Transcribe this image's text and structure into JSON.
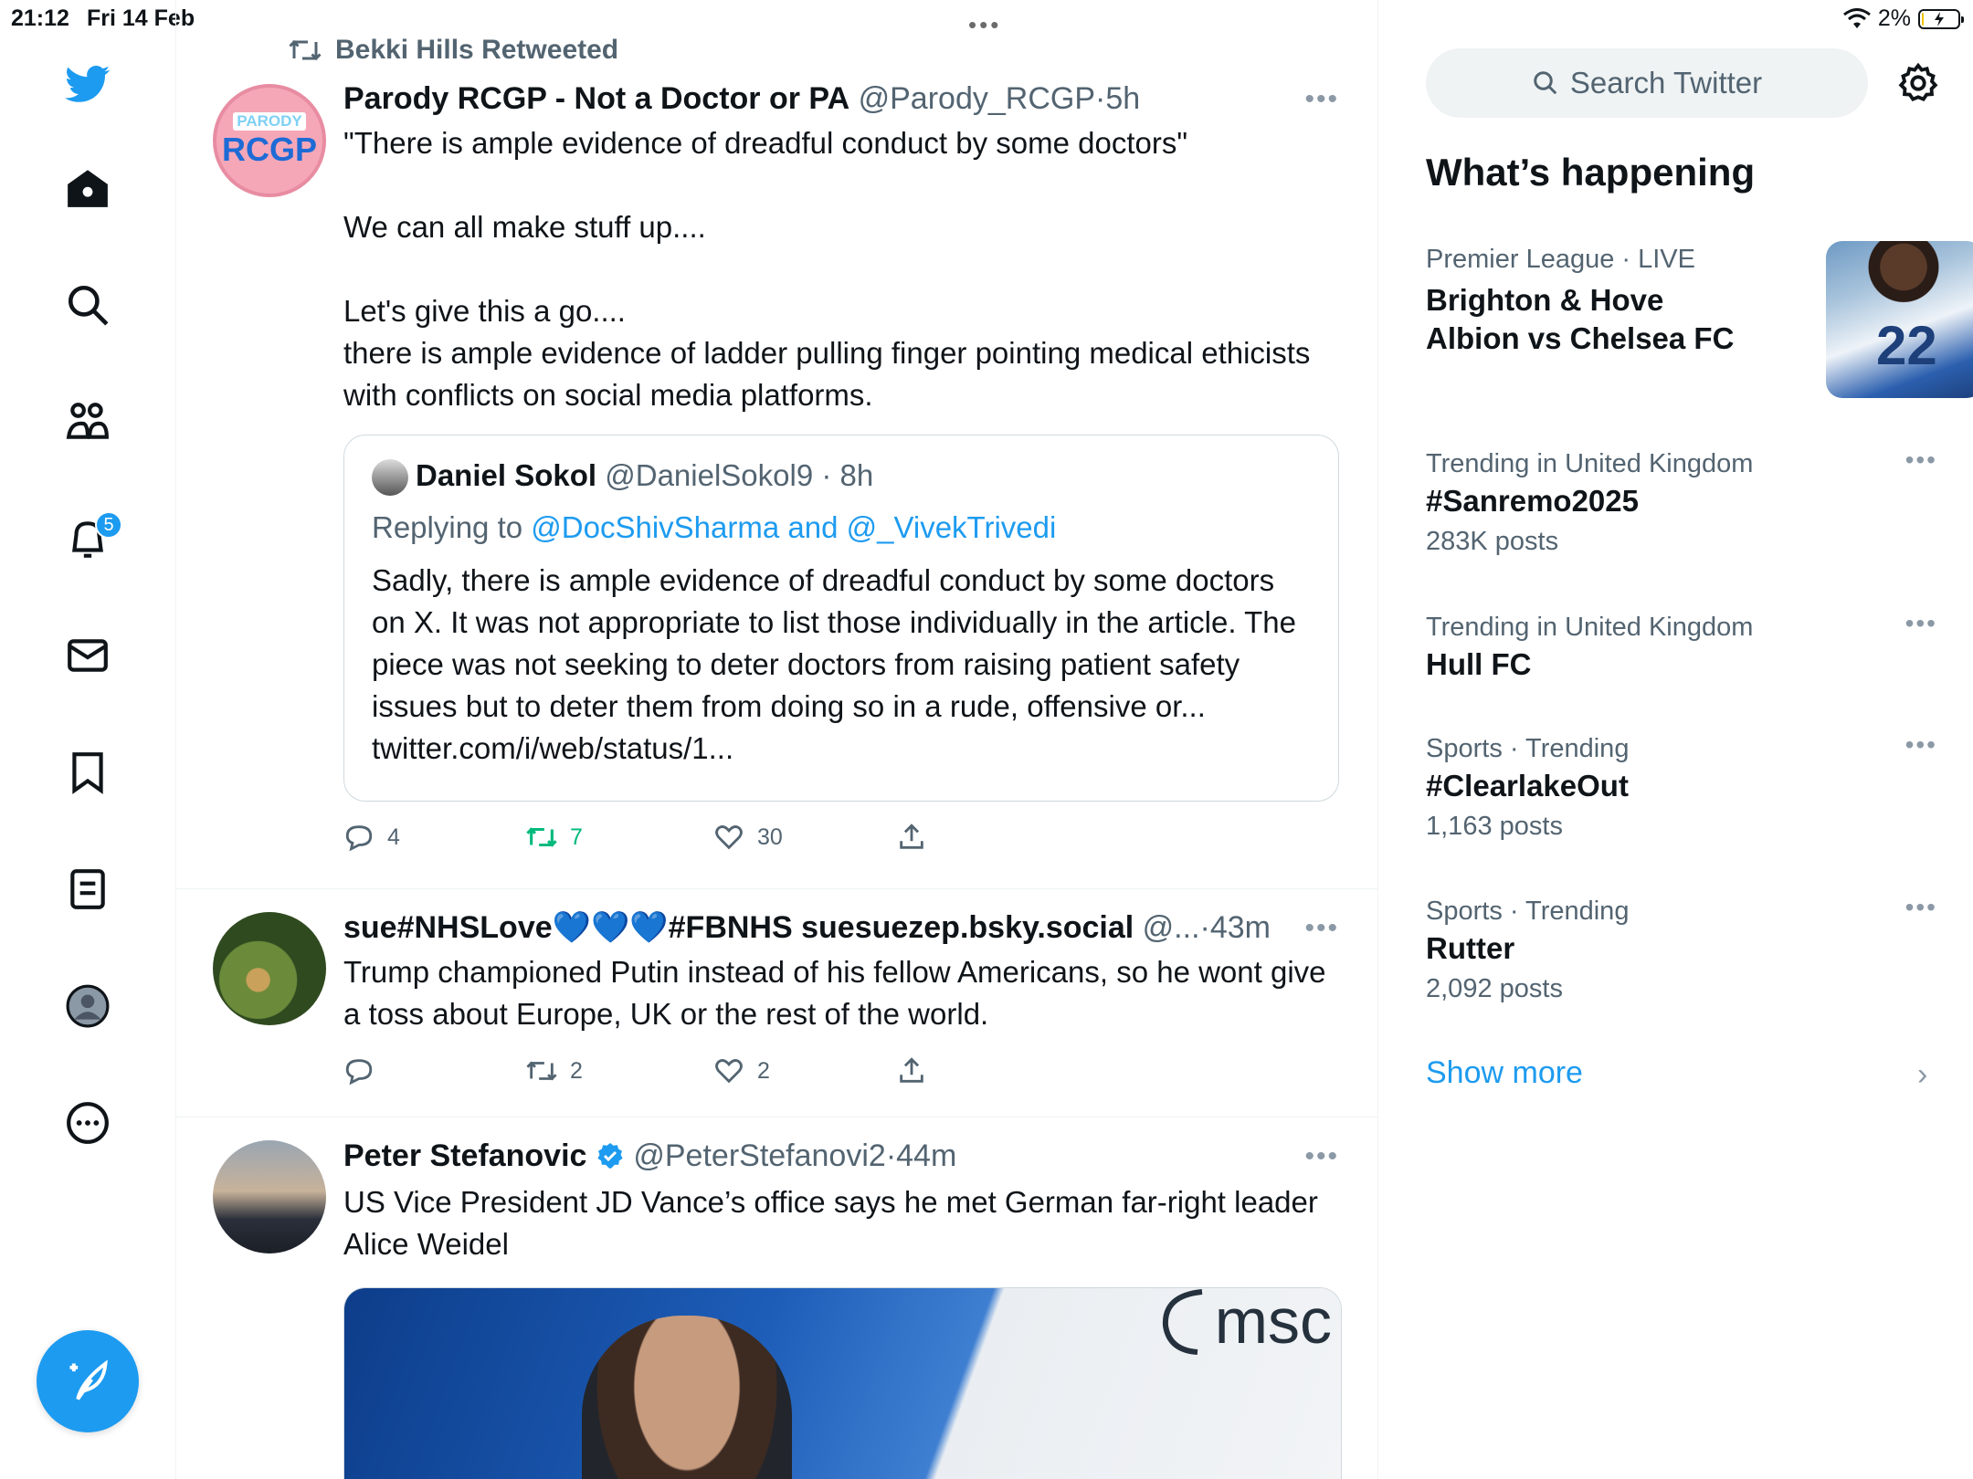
{
  "status_bar": {
    "time": "21:12",
    "date": "Fri 14 Feb",
    "battery": "2%",
    "battery_level": 0.02
  },
  "nav": {
    "notifications_badge": "5",
    "icons": [
      "twitter-logo-icon",
      "home-icon",
      "search-icon",
      "communities-icon",
      "notifications-icon",
      "messages-icon",
      "bookmarks-icon",
      "lists-icon",
      "profile-icon",
      "more-icon",
      "compose-icon"
    ]
  },
  "feed": {
    "tweets": [
      {
        "retweeted_by": "Bekki Hills Retweeted",
        "name": "Parody RCGP - Not a Doctor or PA",
        "handle": "@Parody_RCGP",
        "sep": "·",
        "time": "5h",
        "avatar_tag": "PARODY",
        "avatar_text": "RCGP",
        "text": "\"There is ample evidence of dreadful conduct by some doctors\"\n\nWe can all make stuff up....\n\nLet's give this a go....\nthere is ample evidence of ladder pulling finger pointing medical ethicists with conflicts on social media platforms.",
        "quote": {
          "name": "Daniel Sokol",
          "handle": "@DanielSokol9",
          "time": "8h",
          "replying_prefix": "Replying to ",
          "replying_to": "@DocShivSharma and @_VivekTrivedi",
          "text": "Sadly, there is ample evidence of dreadful conduct by some doctors on X. It was not appropriate to list those individually in the article. The piece was not seeking to deter doctors from raising patient safety issues but to deter them from doing so in a rude, offensive or... twitter.com/i/web/status/1..."
        },
        "replies": "4",
        "retweets": "7",
        "likes": "30"
      },
      {
        "name": "sue#NHSLove💙💙💙#FBNHS suesuezep.bsky.social",
        "handle": "@...",
        "sep": "·",
        "time": "43m",
        "text": "Trump championed Putin instead of his fellow Americans, so he wont give a toss about Europe, UK or the rest of the world.",
        "replies": "",
        "retweets": "2",
        "likes": "2"
      },
      {
        "name": "Peter Stefanovic",
        "handle": "@PeterStefanovi2",
        "sep": "·",
        "time": "44m",
        "text": "US Vice President JD Vance’s office says he met German far-right leader Alice Weidel",
        "media_logo": "msc"
      }
    ]
  },
  "sidebar": {
    "search_placeholder": "Search Twitter",
    "section_title": "What’s happening",
    "trends": [
      {
        "category": "Premier League",
        "live": "· LIVE",
        "name_line1": "Brighton & Hove",
        "name_line2": "Albion vs Chelsea FC",
        "thumb_number": "22"
      },
      {
        "category": "Trending in United Kingdom",
        "name": "#Sanremo2025",
        "count": "283K posts"
      },
      {
        "category": "Trending in United Kingdom",
        "name": "Hull FC",
        "count": ""
      },
      {
        "category": "Sports · Trending",
        "name": "#ClearlakeOut",
        "count": "1,163 posts"
      },
      {
        "category": "Sports · Trending",
        "name": "Rutter",
        "count": "2,092 posts"
      }
    ],
    "show_more": "Show more"
  },
  "colors": {
    "accent": "#1d9bf0",
    "retweet_green": "#00ba7c",
    "secondary_text": "#536471",
    "border": "#eff3f4"
  }
}
